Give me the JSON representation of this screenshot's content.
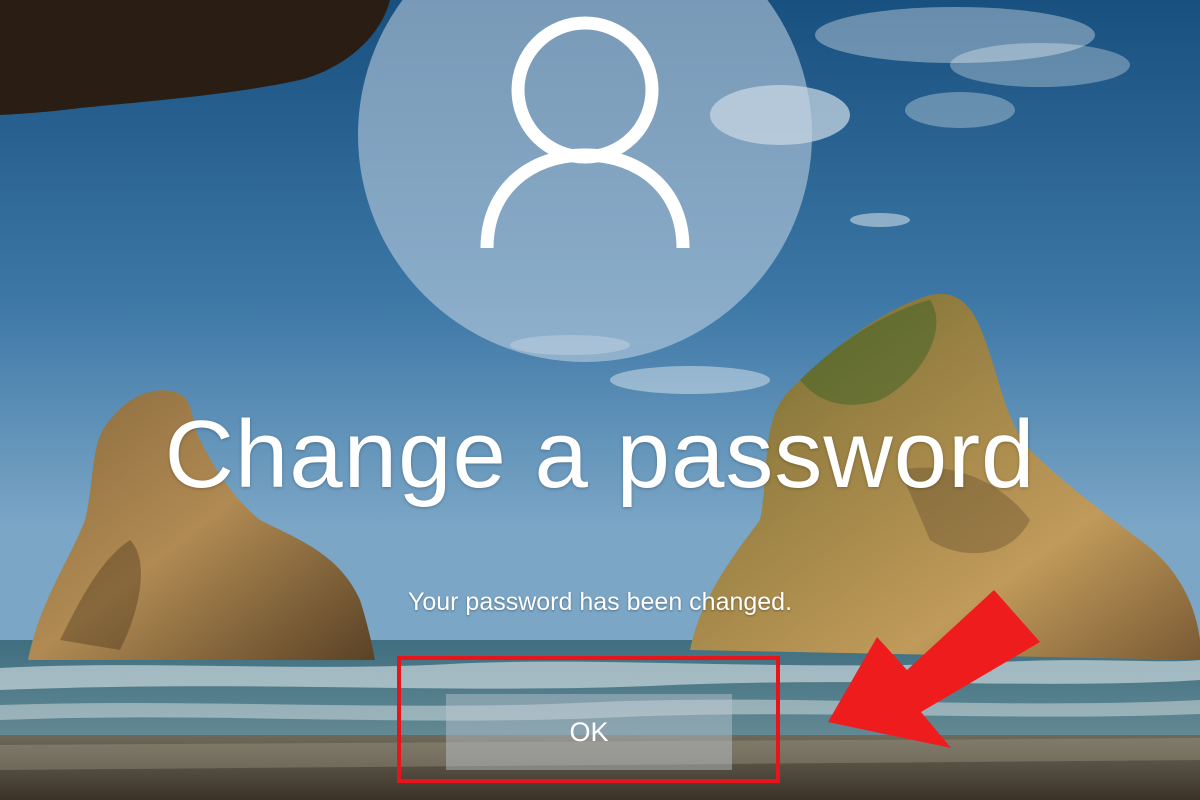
{
  "screen": {
    "title": "Change a password",
    "message": "Your password has been changed.",
    "ok_label": "OK"
  },
  "avatar": {
    "icon": "user-silhouette-icon"
  },
  "annotation": {
    "highlight_color": "#e8141b",
    "arrow_color": "#ee1c1c",
    "points_to": "ok-button"
  },
  "colors": {
    "sky_top": "#1d5a8c",
    "sky_bottom": "#6f9dbf",
    "text": "#ffffff"
  }
}
